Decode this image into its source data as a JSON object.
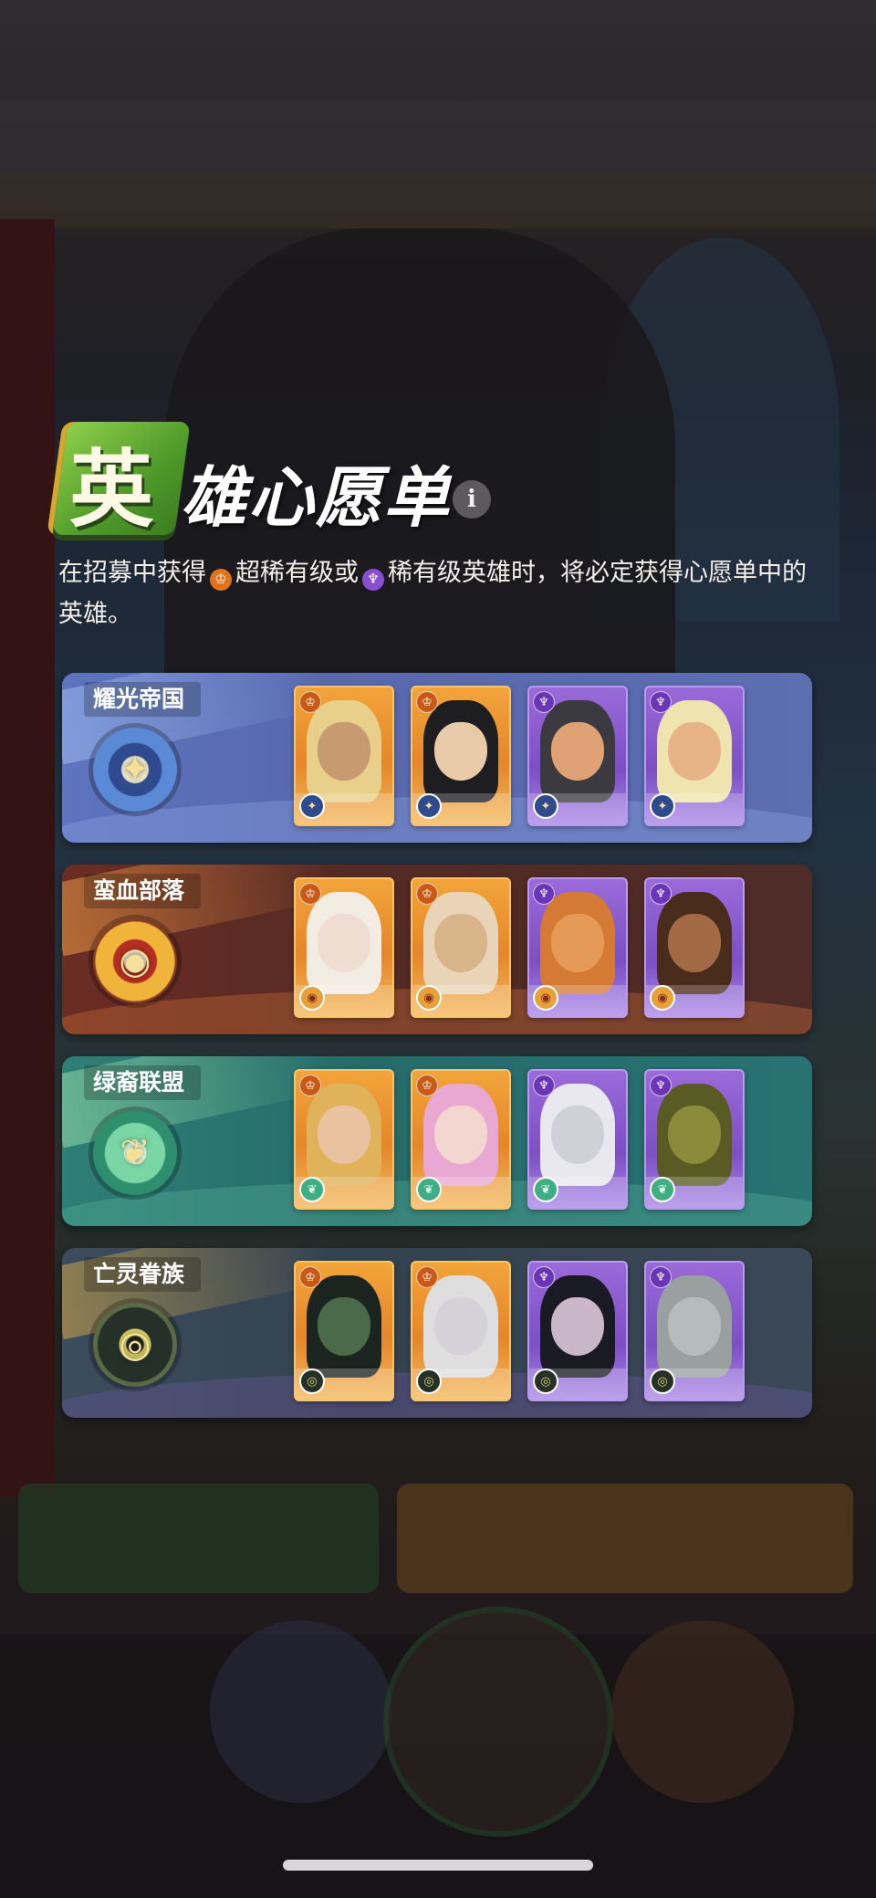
{
  "dialog": {
    "title_badge_char": "英",
    "title_rest": "雄心愿单",
    "info_icon": "i",
    "description": {
      "part1": "在招募中获得",
      "ssr_icon": "♔",
      "part2": "超稀有级或",
      "sr_icon": "♆",
      "part3": "稀有级英雄时，将必定获得心愿单中的英雄。"
    }
  },
  "factions": [
    {
      "name": "耀光帝国",
      "emblem_icon": "✦",
      "heroes": [
        {
          "rank": "ssr",
          "rank_icon": "♔",
          "faction_icon": "✦",
          "hair": "#e8d08a",
          "skin": "#c89a70"
        },
        {
          "rank": "ssr",
          "rank_icon": "♔",
          "faction_icon": "✦",
          "hair": "#1e1e20",
          "skin": "#e8c9a8"
        },
        {
          "rank": "sr",
          "rank_icon": "♆",
          "faction_icon": "✦",
          "hair": "#3a3a40",
          "skin": "#e0a274"
        },
        {
          "rank": "sr",
          "rank_icon": "♆",
          "faction_icon": "✦",
          "hair": "#efe4b0",
          "skin": "#e7b387"
        }
      ]
    },
    {
      "name": "蛮血部落",
      "emblem_icon": "◉",
      "heroes": [
        {
          "rank": "ssr",
          "rank_icon": "♔",
          "faction_icon": "◉",
          "hair": "#f2ece2",
          "skin": "#f0ddd2"
        },
        {
          "rank": "ssr",
          "rank_icon": "♔",
          "faction_icon": "◉",
          "hair": "#e9d4b8",
          "skin": "#d8b48a"
        },
        {
          "rank": "sr",
          "rank_icon": "♆",
          "faction_icon": "◉",
          "hair": "#d47a35",
          "skin": "#e59a58"
        },
        {
          "rank": "sr",
          "rank_icon": "♆",
          "faction_icon": "◉",
          "hair": "#4a2c1c",
          "skin": "#a26a44"
        }
      ]
    },
    {
      "name": "绿裔联盟",
      "emblem_icon": "❦",
      "heroes": [
        {
          "rank": "ssr",
          "rank_icon": "♔",
          "faction_icon": "❦",
          "hair": "#e0b25a",
          "skin": "#e9c3a0"
        },
        {
          "rank": "ssr",
          "rank_icon": "♔",
          "faction_icon": "❦",
          "hair": "#e9a8d2",
          "skin": "#f3d6d0"
        },
        {
          "rank": "sr",
          "rank_icon": "♆",
          "faction_icon": "❦",
          "hair": "#e8e8ee",
          "skin": "#cfd0d8"
        },
        {
          "rank": "sr",
          "rank_icon": "♆",
          "faction_icon": "❦",
          "hair": "#5a5a24",
          "skin": "#8a8a3a"
        }
      ]
    },
    {
      "name": "亡灵眷族",
      "emblem_icon": "◎",
      "heroes": [
        {
          "rank": "ssr",
          "rank_icon": "♔",
          "faction_icon": "◎",
          "hair": "#1c2420",
          "skin": "#4a6a4a"
        },
        {
          "rank": "ssr",
          "rank_icon": "♔",
          "faction_icon": "◎",
          "hair": "#dedede",
          "skin": "#d4d2d8"
        },
        {
          "rank": "sr",
          "rank_icon": "♆",
          "faction_icon": "◎",
          "hair": "#1a1a24",
          "skin": "#c9b6c8"
        },
        {
          "rank": "sr",
          "rank_icon": "♆",
          "faction_icon": "◎",
          "hair": "#9aa0a0",
          "skin": "#b6bcbc"
        }
      ]
    }
  ],
  "colors": {
    "ssr": "#e5862a",
    "sr": "#7c4fc4",
    "title_badge": "#4f9a2a"
  }
}
